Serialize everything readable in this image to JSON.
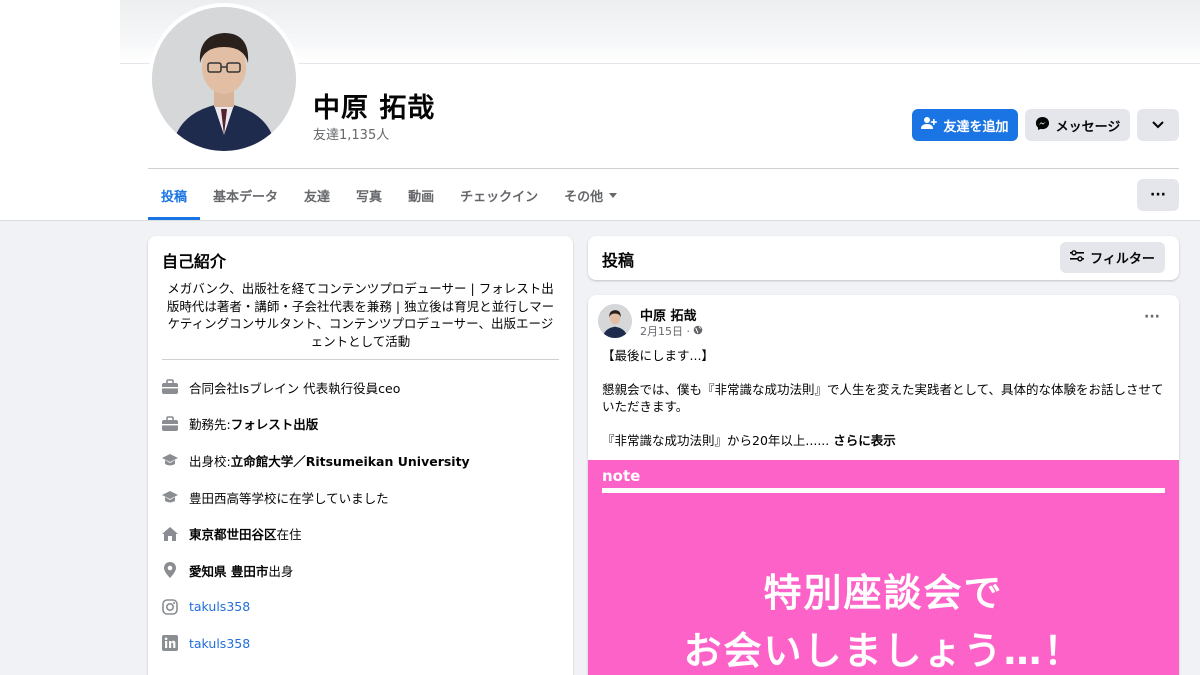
{
  "profile": {
    "name": "中原 拓哉",
    "friends_count": "友達1,135人",
    "colors": {
      "primary": "#1b74e4",
      "secondary_button": "#e4e6eb",
      "post_image": "#fd62c8"
    }
  },
  "actions": {
    "add_friend": "友達を追加",
    "message": "メッセージ"
  },
  "tabs": [
    {
      "label": "投稿",
      "active": true
    },
    {
      "label": "基本データ"
    },
    {
      "label": "友達"
    },
    {
      "label": "写真"
    },
    {
      "label": "動画"
    },
    {
      "label": "チェックイン"
    },
    {
      "label": "その他"
    }
  ],
  "more_button": "···",
  "intro": {
    "title": "自己紹介",
    "bio": "メガバンク、出版社を経てコンテンツプロデューサー | フォレスト出版時代は著者・講師・子会社代表を兼務 | 独立後は育児と並行しマーケティングコンサルタント、コンテンツプロデューサー、出版エージェントとして活動",
    "rows": [
      {
        "icon": "briefcase-icon",
        "text": "合同会社Isブレイン 代表執行役員ceo"
      },
      {
        "icon": "briefcase-icon",
        "prefix": "勤務先: ",
        "bold": "フォレスト出版"
      },
      {
        "icon": "graduation-cap-icon",
        "prefix": "出身校: ",
        "bold": "立命館大学／Ritsumeikan University"
      },
      {
        "icon": "graduation-cap-icon",
        "text": "豊田西高等学校に在学していました"
      },
      {
        "icon": "home-icon",
        "bold": "東京都世田谷区",
        "suffix": "在住"
      },
      {
        "icon": "location-pin-icon",
        "bold": "愛知県 豊田市",
        "suffix": "出身"
      },
      {
        "icon": "instagram-icon",
        "link": "takuls358"
      },
      {
        "icon": "linkedin-icon",
        "link": "takuls358"
      }
    ]
  },
  "posts": {
    "title": "投稿",
    "filter_label": "フィルター",
    "post": {
      "author": "中原 拓哉",
      "date": "2月15日 ·",
      "menu": "···",
      "paragraphs": [
        "【最後にします...】",
        "懇親会では、僕も『非常識な成功法則』で人生を変えた実践者として、具体的な体験をお話しさせていただきます。",
        "『非常識な成功法則』から20年以上......"
      ],
      "see_more": "さらに表示",
      "image": {
        "label": "note",
        "line1": "特別座談会で",
        "line2": "お会いしましょう…！"
      }
    }
  }
}
